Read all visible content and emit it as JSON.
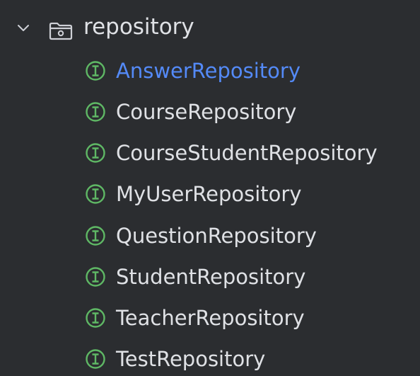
{
  "tree": {
    "folder": {
      "label": "repository",
      "icon": "folder-icon",
      "expanded": true
    },
    "items": [
      {
        "label": "AnswerRepository",
        "icon": "interface-icon",
        "selected": true
      },
      {
        "label": "CourseRepository",
        "icon": "interface-icon",
        "selected": false
      },
      {
        "label": "CourseStudentRepository",
        "icon": "interface-icon",
        "selected": false
      },
      {
        "label": "MyUserRepository",
        "icon": "interface-icon",
        "selected": false
      },
      {
        "label": "QuestionRepository",
        "icon": "interface-icon",
        "selected": false
      },
      {
        "label": "StudentRepository",
        "icon": "interface-icon",
        "selected": false
      },
      {
        "label": "TeacherRepository",
        "icon": "interface-icon",
        "selected": false
      },
      {
        "label": "TestRepository",
        "icon": "interface-icon",
        "selected": false
      }
    ]
  },
  "colors": {
    "background": "#2b2d30",
    "text": "#dfe1e5",
    "selected_text": "#548af7",
    "interface_icon": "#5fb865",
    "folder_icon": "#ced0d6"
  }
}
